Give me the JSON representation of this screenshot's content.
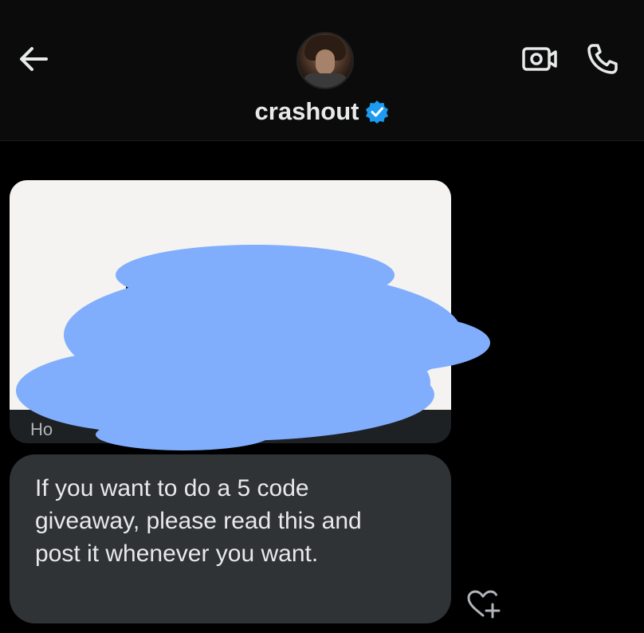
{
  "header": {
    "title": "crashout",
    "icons": {
      "back": "arrow-left-icon",
      "verified": "verified-badge-icon",
      "video": "video-call-icon",
      "phone": "phone-icon"
    }
  },
  "shared_post": {
    "caption": "Ho"
  },
  "message": {
    "text": "If you want to do a 5 code\ngiveaway, please read this and\npost it whenever you want."
  },
  "reaction": {
    "icon": "heart-plus-icon"
  },
  "colors": {
    "background": "#000000",
    "header": "#0b0b0b",
    "bubble": "#303336",
    "verified": "#1d9bf0",
    "redaction": "#80aefd"
  }
}
